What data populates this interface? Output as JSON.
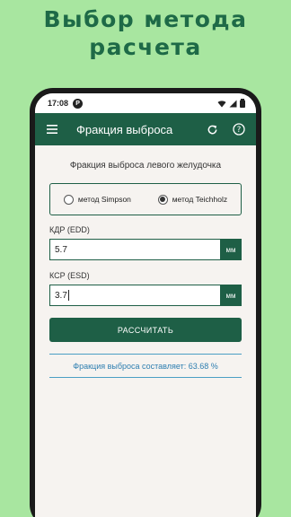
{
  "promo": {
    "line1": "Выбор метода",
    "line2": "расчета"
  },
  "status_bar": {
    "time": "17:08",
    "badge": "P"
  },
  "app_bar": {
    "title": "Фракция выброса",
    "icons": [
      "menu-icon",
      "refresh-icon",
      "help-icon"
    ]
  },
  "form": {
    "subtitle": "Фракция выброса левого желудочка",
    "methods": [
      {
        "label": "метод Simpson",
        "selected": false
      },
      {
        "label": "метод Teichholz",
        "selected": true
      }
    ],
    "edd": {
      "label": "КДР (EDD)",
      "value": "5.7",
      "unit": "мм"
    },
    "esd": {
      "label": "КСР (ESD)",
      "value": "3.7",
      "unit": "мм"
    },
    "calculate_label": "РАССЧИТАТЬ",
    "result_text": "Фракция выброса составляет: 63.68 %"
  },
  "colors": {
    "background": "#a8e6a0",
    "primary": "#1e5f46",
    "result": "#2d7eb0"
  }
}
